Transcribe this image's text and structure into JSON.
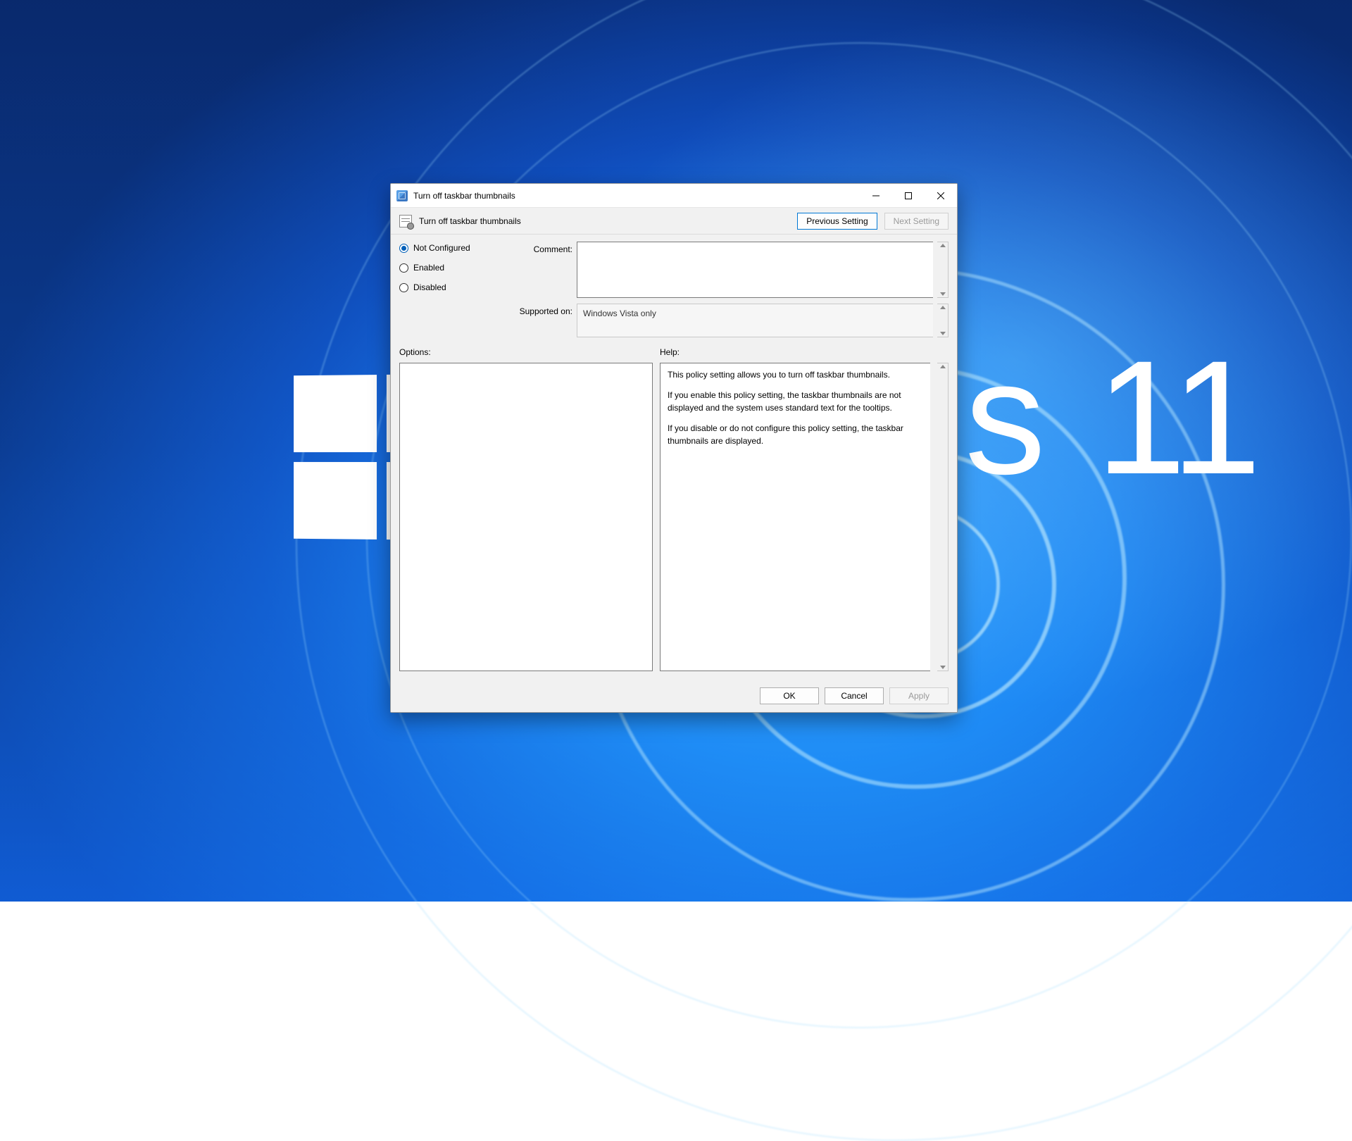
{
  "desktop": {
    "os_label": "11"
  },
  "window": {
    "title": "Turn off taskbar thumbnails",
    "setting_name": "Turn off taskbar thumbnails",
    "nav": {
      "prev": "Previous Setting",
      "next": "Next Setting"
    },
    "state": {
      "options": {
        "not_configured": "Not Configured",
        "enabled": "Enabled",
        "disabled": "Disabled"
      },
      "selected": "not_configured"
    },
    "labels": {
      "comment": "Comment:",
      "supported": "Supported on:",
      "options": "Options:",
      "help": "Help:"
    },
    "comment": "",
    "supported_on": "Windows Vista only",
    "help": {
      "p1": "This policy setting allows you to turn off taskbar thumbnails.",
      "p2": "If you enable this policy setting, the taskbar thumbnails are not displayed and the system uses standard text for the tooltips.",
      "p3": "If you disable or do not configure this policy setting, the taskbar thumbnails are displayed."
    },
    "footer": {
      "ok": "OK",
      "cancel": "Cancel",
      "apply": "Apply"
    }
  }
}
